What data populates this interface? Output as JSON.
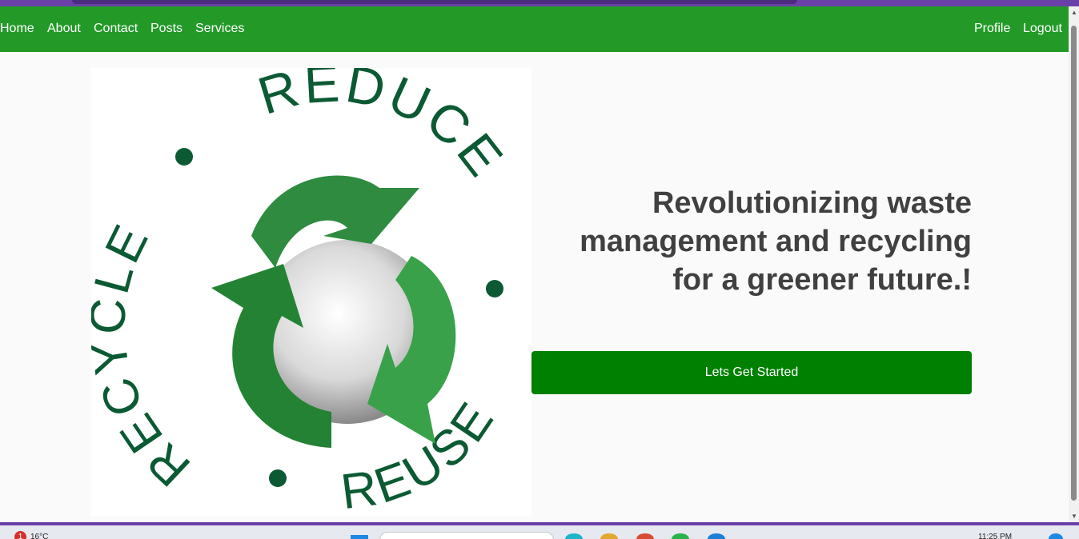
{
  "navbar": {
    "left_links": [
      "Home",
      "About",
      "Contact",
      "Posts",
      "Services"
    ],
    "right_links": [
      "Profile",
      "Logout"
    ],
    "background": "#239a28"
  },
  "hero": {
    "image": {
      "label_top": "REDUCE",
      "label_left": "RECYCLE",
      "label_right": "REUSE",
      "icon": "recycle-icon"
    },
    "title": "Revolutionizing waste management and recycling for a greener future.!",
    "cta_label": "Lets Get Started",
    "cta_color": "#008000",
    "title_color": "#404040"
  },
  "taskbar": {
    "notification_count": "1",
    "temperature": "16°C",
    "time": "11:25 PM"
  }
}
